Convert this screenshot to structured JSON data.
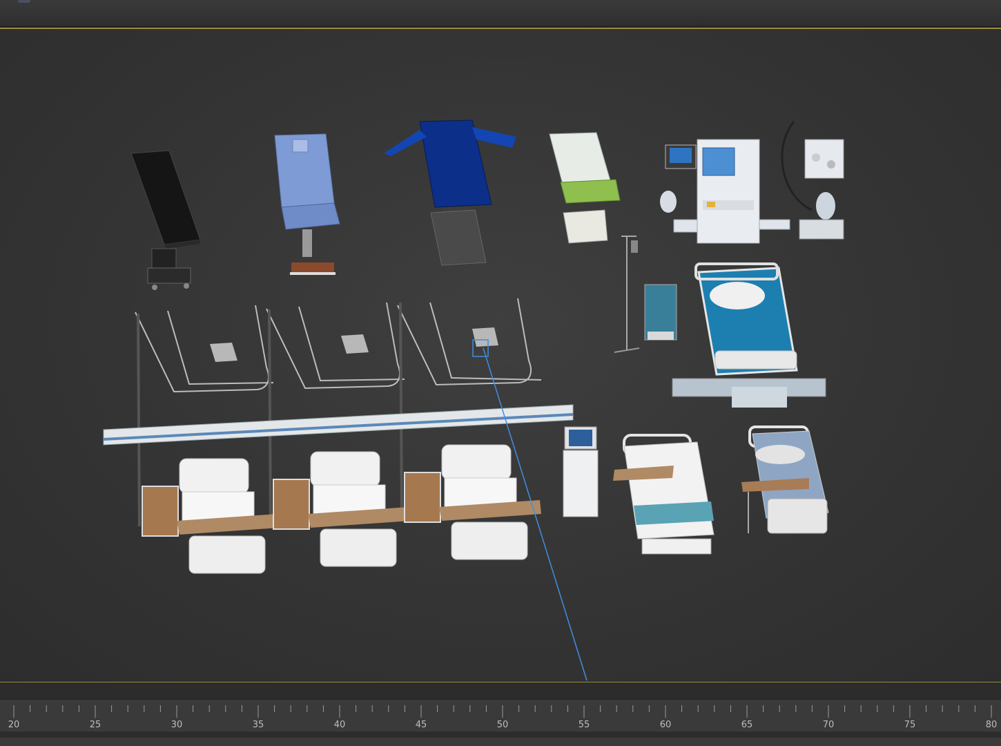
{
  "window": {
    "viewport_label": "",
    "selection_color": "#3f8fe0",
    "border_color": "#9a8a3a",
    "background_color": "#3a3a3a"
  },
  "scene_objects": [
    {
      "id": "operating-table-black",
      "icon": "operating-table"
    },
    {
      "id": "gynecological-chair-blue",
      "icon": "exam-chair"
    },
    {
      "id": "surgical-table-dark-blue",
      "icon": "surgical-table"
    },
    {
      "id": "delivery-bed-green",
      "icon": "delivery-bed"
    },
    {
      "id": "anesthesia-machine",
      "icon": "anesthesia-machine"
    },
    {
      "id": "suction-unit",
      "icon": "suction-unit"
    },
    {
      "id": "iv-stand",
      "icon": "iv-stand"
    },
    {
      "id": "bedside-cabinet-blue",
      "icon": "cabinet"
    },
    {
      "id": "icu-bed-blue",
      "icon": "hospital-bed"
    },
    {
      "id": "ceiling-curtain-tracks",
      "icon": "curtain-track"
    },
    {
      "id": "medical-gas-panel",
      "icon": "gas-panel"
    },
    {
      "id": "ward-bed-1",
      "icon": "hospital-bed"
    },
    {
      "id": "ward-bed-2",
      "icon": "hospital-bed"
    },
    {
      "id": "ward-bed-3",
      "icon": "hospital-bed"
    },
    {
      "id": "ultrasound-machine",
      "icon": "ultrasound"
    },
    {
      "id": "hospital-bed-teal",
      "icon": "hospital-bed"
    },
    {
      "id": "hospital-bed-grey",
      "icon": "hospital-bed"
    }
  ],
  "timeline": {
    "ticks": [
      "20",
      "25",
      "30",
      "35",
      "40",
      "45",
      "50",
      "55",
      "60",
      "65",
      "70",
      "75",
      "80"
    ],
    "start": 20,
    "end": 80,
    "minor_step": 1
  }
}
